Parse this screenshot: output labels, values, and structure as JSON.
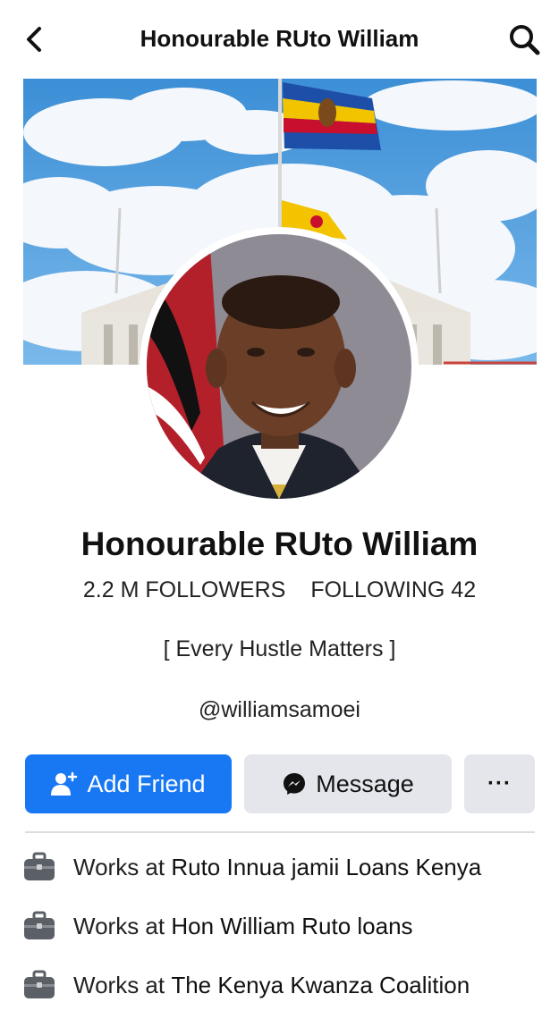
{
  "header": {
    "title": "Honourable RUto William",
    "back_icon": "chevron-left-icon",
    "search_icon": "search-icon"
  },
  "profile": {
    "name": "Honourable RUto William",
    "followers": "2.2 M FOLLOWERS",
    "following": "FOLLOWING 42",
    "bio": "[ Every Hustle Matters ]",
    "handle": "@williamsamoei"
  },
  "actions": {
    "add_friend_label": "Add Friend",
    "message_label": "Message",
    "more_label": "···"
  },
  "work": [
    {
      "prefix": "Works at",
      "org": "Ruto Innua jamii Loans Kenya"
    },
    {
      "prefix": "Works at",
      "org": "Hon William Ruto loans"
    },
    {
      "prefix": "Works at",
      "org": "The Kenya Kwanza Coalition"
    }
  ],
  "colors": {
    "accent": "#1877f2",
    "secondary_button": "#e4e6eb"
  }
}
